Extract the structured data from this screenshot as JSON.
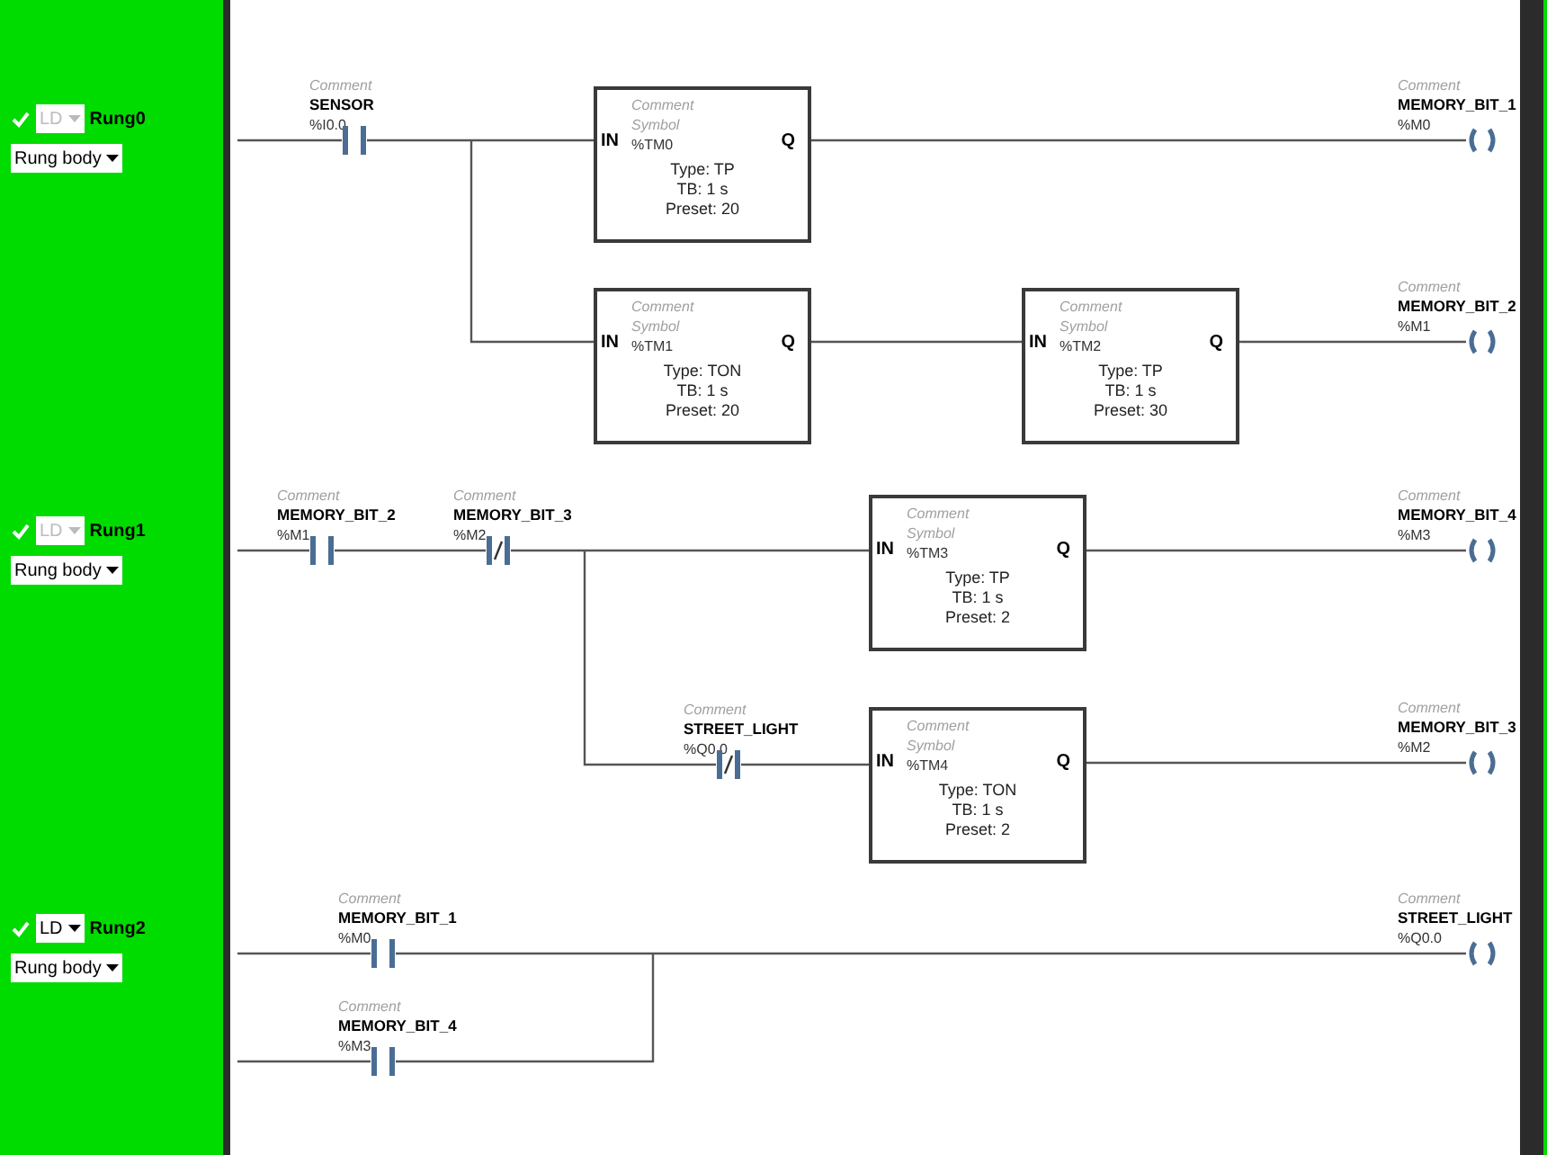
{
  "rungs": [
    {
      "checked": true,
      "language": {
        "label": "LD",
        "disabled": true
      },
      "name": "Rung0",
      "section": "Rung body",
      "contacts": [
        {
          "kind": "no",
          "comment": "Comment",
          "symbol": "SENSOR",
          "address": "%I0.0"
        }
      ],
      "blocks": [
        {
          "comment": "Comment",
          "symbol": "Symbol",
          "address": "%TM0",
          "input": "IN",
          "output": "Q",
          "type": "Type: TP",
          "tb": "TB: 1 s",
          "preset": "Preset: 20"
        },
        {
          "comment": "Comment",
          "symbol": "Symbol",
          "address": "%TM1",
          "input": "IN",
          "output": "Q",
          "type": "Type: TON",
          "tb": "TB: 1 s",
          "preset": "Preset: 20"
        },
        {
          "comment": "Comment",
          "symbol": "Symbol",
          "address": "%TM2",
          "input": "IN",
          "output": "Q",
          "type": "Type: TP",
          "tb": "TB: 1 s",
          "preset": "Preset: 30"
        }
      ],
      "coils": [
        {
          "comment": "Comment",
          "symbol": "MEMORY_BIT_1",
          "address": "%M0"
        },
        {
          "comment": "Comment",
          "symbol": "MEMORY_BIT_2",
          "address": "%M1"
        }
      ]
    },
    {
      "checked": true,
      "language": {
        "label": "LD",
        "disabled": true
      },
      "name": "Rung1",
      "section": "Rung body",
      "contacts": [
        {
          "kind": "no",
          "comment": "Comment",
          "symbol": "MEMORY_BIT_2",
          "address": "%M1"
        },
        {
          "kind": "nc",
          "comment": "Comment",
          "symbol": "MEMORY_BIT_3",
          "address": "%M2"
        },
        {
          "kind": "nc",
          "comment": "Comment",
          "symbol": "STREET_LIGHT",
          "address": "%Q0.0"
        }
      ],
      "blocks": [
        {
          "comment": "Comment",
          "symbol": "Symbol",
          "address": "%TM3",
          "input": "IN",
          "output": "Q",
          "type": "Type: TP",
          "tb": "TB: 1 s",
          "preset": "Preset: 2"
        },
        {
          "comment": "Comment",
          "symbol": "Symbol",
          "address": "%TM4",
          "input": "IN",
          "output": "Q",
          "type": "Type: TON",
          "tb": "TB: 1 s",
          "preset": "Preset: 2"
        }
      ],
      "coils": [
        {
          "comment": "Comment",
          "symbol": "MEMORY_BIT_4",
          "address": "%M3"
        },
        {
          "comment": "Comment",
          "symbol": "MEMORY_BIT_3",
          "address": "%M2"
        }
      ]
    },
    {
      "checked": true,
      "language": {
        "label": "LD",
        "disabled": false
      },
      "name": "Rung2",
      "section": "Rung body",
      "contacts": [
        {
          "kind": "no",
          "comment": "Comment",
          "symbol": "MEMORY_BIT_1",
          "address": "%M0"
        },
        {
          "kind": "no",
          "comment": "Comment",
          "symbol": "MEMORY_BIT_4",
          "address": "%M3"
        }
      ],
      "coils": [
        {
          "comment": "Comment",
          "symbol": "STREET_LIGHT",
          "address": "%Q0.0"
        }
      ]
    }
  ]
}
